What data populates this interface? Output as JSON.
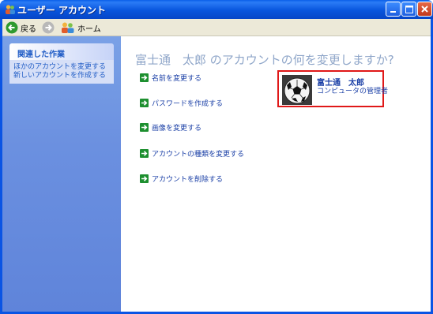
{
  "window": {
    "title": "ユーザー アカウント"
  },
  "toolbar": {
    "back_label": "戻る",
    "home_label": "ホーム"
  },
  "sidebar": {
    "heading": "関連した作業",
    "links": [
      "ほかのアカウントを変更する",
      "新しいアカウントを作成する"
    ]
  },
  "main": {
    "heading": "富士通　太郎 のアカウントの何を変更しますか?",
    "actions": [
      "名前を変更する",
      "パスワードを作成する",
      "画像を変更する",
      "アカウントの種類を変更する",
      "アカウントを削除する"
    ]
  },
  "account": {
    "name": "富士通　太郎",
    "role": "コンピュータの管理者",
    "picture": "soccer-ball",
    "highlight_color": "#e01818"
  },
  "icons": {
    "title": "users-icon",
    "back": "back-arrow-icon",
    "forward": "forward-arrow-icon",
    "home": "users-home-icon",
    "action": "green-arrow-icon"
  }
}
